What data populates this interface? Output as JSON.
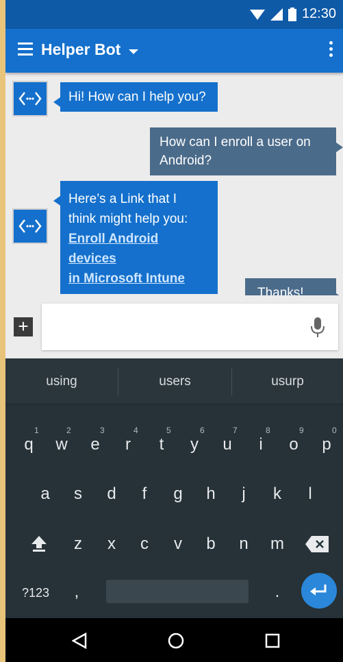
{
  "status_bar": {
    "time": "12:30",
    "icons": [
      "wifi-icon",
      "signal-icon",
      "battery-icon"
    ]
  },
  "app_bar": {
    "title": "Helper Bot",
    "menu_icon": "hamburger-icon",
    "dropdown_icon": "caret-down-icon",
    "overflow_icon": "more-vert-icon"
  },
  "chat": {
    "messages": [
      {
        "from": "bot",
        "text": "Hi! How can I help you?"
      },
      {
        "from": "user",
        "text_line1": "How can I enroll a user on",
        "text_line2": "Android?"
      },
      {
        "from": "bot",
        "text_line1": "Here’s a Link that I",
        "text_line2": "think might help you:",
        "link_line1": "Enroll Android devices",
        "link_line2": "in Microsoft Intune"
      },
      {
        "from": "user",
        "text": "Thanks!"
      }
    ]
  },
  "input": {
    "value": "",
    "placeholder": ""
  },
  "keyboard": {
    "suggestions": [
      "using",
      "users",
      "usurp"
    ],
    "row1": [
      "q",
      "w",
      "e",
      "r",
      "t",
      "y",
      "u",
      "i",
      "o",
      "p"
    ],
    "row1_hints": [
      "1",
      "2",
      "3",
      "4",
      "5",
      "6",
      "7",
      "8",
      "9",
      "0"
    ],
    "row2": [
      "a",
      "s",
      "d",
      "f",
      "g",
      "h",
      "j",
      "k",
      "l"
    ],
    "row3": [
      "z",
      "x",
      "c",
      "v",
      "b",
      "n",
      "m"
    ],
    "symbols_label": "?123",
    "comma": ",",
    "period": "."
  },
  "colors": {
    "primary": "#1470cc",
    "status_bar": "#0f5aa7",
    "user_bubble": "#4b6b8a",
    "keyboard_bg": "#263238",
    "enter_key": "#2a87d9"
  }
}
